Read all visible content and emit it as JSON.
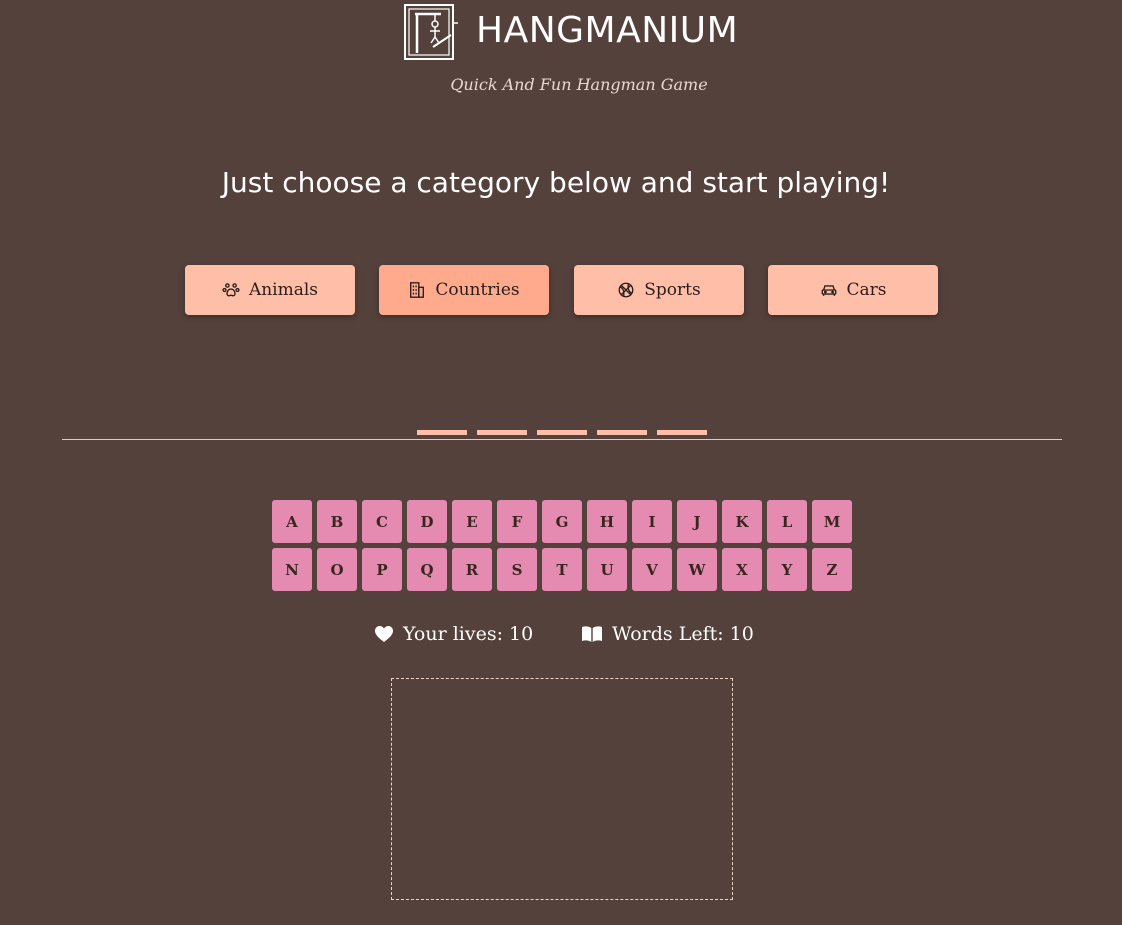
{
  "header": {
    "brand": "HANGMANIUM",
    "tagline": "Quick And Fun Hangman Game",
    "logo_icon": "hangman-logo-icon"
  },
  "headline": "Just choose a category below and start playing!",
  "categories": [
    {
      "label": "Animals",
      "icon": "paw-icon",
      "active": false
    },
    {
      "label": "Countries",
      "icon": "building-icon",
      "active": true
    },
    {
      "label": "Sports",
      "icon": "basketball-icon",
      "active": false
    },
    {
      "label": "Cars",
      "icon": "car-icon",
      "active": false
    }
  ],
  "word": {
    "letter_count": 5
  },
  "keyboard": {
    "row1": [
      "A",
      "B",
      "C",
      "D",
      "E",
      "F",
      "G",
      "H",
      "I",
      "J",
      "K",
      "L",
      "M"
    ],
    "row2": [
      "N",
      "O",
      "P",
      "Q",
      "R",
      "S",
      "T",
      "U",
      "V",
      "W",
      "X",
      "Y",
      "Z"
    ]
  },
  "stats": {
    "lives_label": "Your lives: 10",
    "words_label": "Words Left: 10",
    "lives_icon": "heart-icon",
    "words_icon": "book-icon"
  },
  "colors": {
    "background": "#55413b",
    "category_button": "#ffbea8",
    "category_button_active": "#ffa98d",
    "key": "#e58ab0",
    "accent_line": "#ffbea8"
  }
}
